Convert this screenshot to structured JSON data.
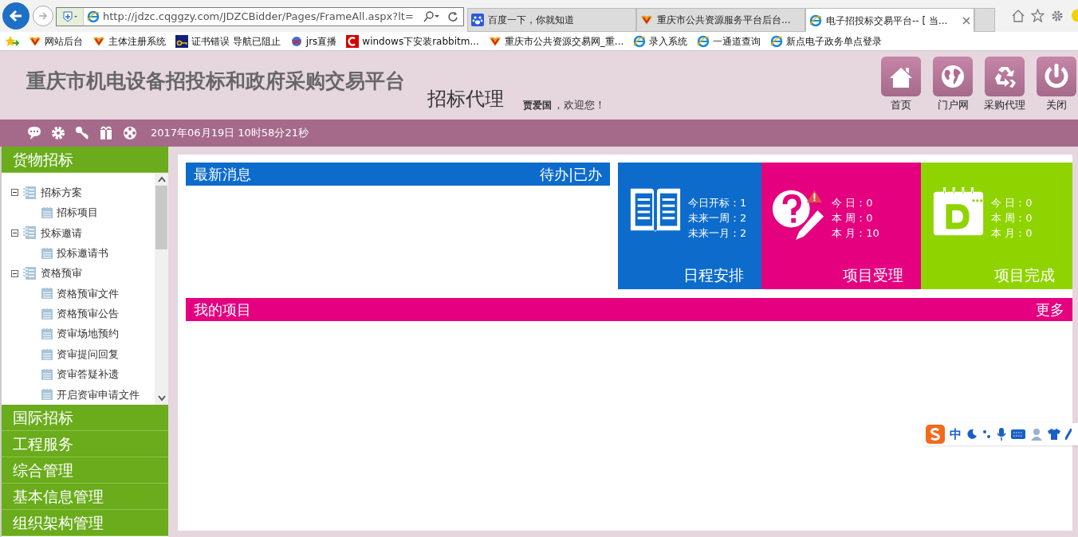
{
  "browser": {
    "url": "http://jdzc.cqggzy.com/JDZCBidder/Pages/FrameAll.aspx?lt=",
    "tabs": [
      {
        "title": "百度一下，你就知道",
        "selected": false
      },
      {
        "title": "重庆市公共资源服务平台后台...",
        "selected": false
      },
      {
        "title": "电子招投标交易平台-- [ 当...",
        "selected": true
      }
    ],
    "bookmarks": [
      "网站后台",
      "主体注册系统",
      "证书错误 导航已阻止",
      "jrs直播",
      "windows下安装rabbitm...",
      "重庆市公共资源交易网_重...",
      "录入系统",
      "一通道查询",
      "新点电子政务单点登录"
    ]
  },
  "header": {
    "title": "重庆市机电设备招投标和政府采购交易平台",
    "role": "招标代理",
    "user": "贾爱国",
    "greeting": "，欢迎您！",
    "nav": [
      "首页",
      "门户网",
      "采购代理",
      "关闭"
    ]
  },
  "toolbar": {
    "datetime": "2017年06月19日 10时58分21秒"
  },
  "sidebar": {
    "sections": [
      {
        "label": "货物招标",
        "children": [
          {
            "label": "招标方案",
            "expanded": true,
            "children": [
              {
                "label": "招标项目"
              }
            ]
          },
          {
            "label": "投标邀请",
            "expanded": true,
            "children": [
              {
                "label": "投标邀请书"
              }
            ]
          },
          {
            "label": "资格预审",
            "expanded": true,
            "children": [
              {
                "label": "资格预审文件"
              },
              {
                "label": "资格预审公告"
              },
              {
                "label": "资审场地预约"
              },
              {
                "label": "资审提问回复"
              },
              {
                "label": "资审答疑补遗"
              },
              {
                "label": "开启资审申请文件"
              }
            ]
          }
        ]
      },
      {
        "label": "国际招标"
      },
      {
        "label": "工程服务"
      },
      {
        "label": "综合管理"
      },
      {
        "label": "基本信息管理"
      },
      {
        "label": "组织架构管理"
      }
    ]
  },
  "news": {
    "title": "最新消息",
    "links": "待办|已办"
  },
  "tiles": [
    {
      "title": "日程安排",
      "color": "#0d6bcc",
      "stats": [
        "今日开标：1",
        "未来一周：2",
        "未来一月：2"
      ]
    },
    {
      "title": "项目受理",
      "color": "#e4007f",
      "stats": [
        "今 日：0",
        "本 周：0",
        "本 月：10"
      ]
    },
    {
      "title": "项目完成",
      "color": "#8fd400",
      "stats": [
        "今 日：0",
        "本 周：0",
        "本 月：0"
      ]
    }
  ],
  "projects": {
    "title": "我的项目",
    "more": "更多"
  },
  "ime": {
    "label": "中"
  }
}
